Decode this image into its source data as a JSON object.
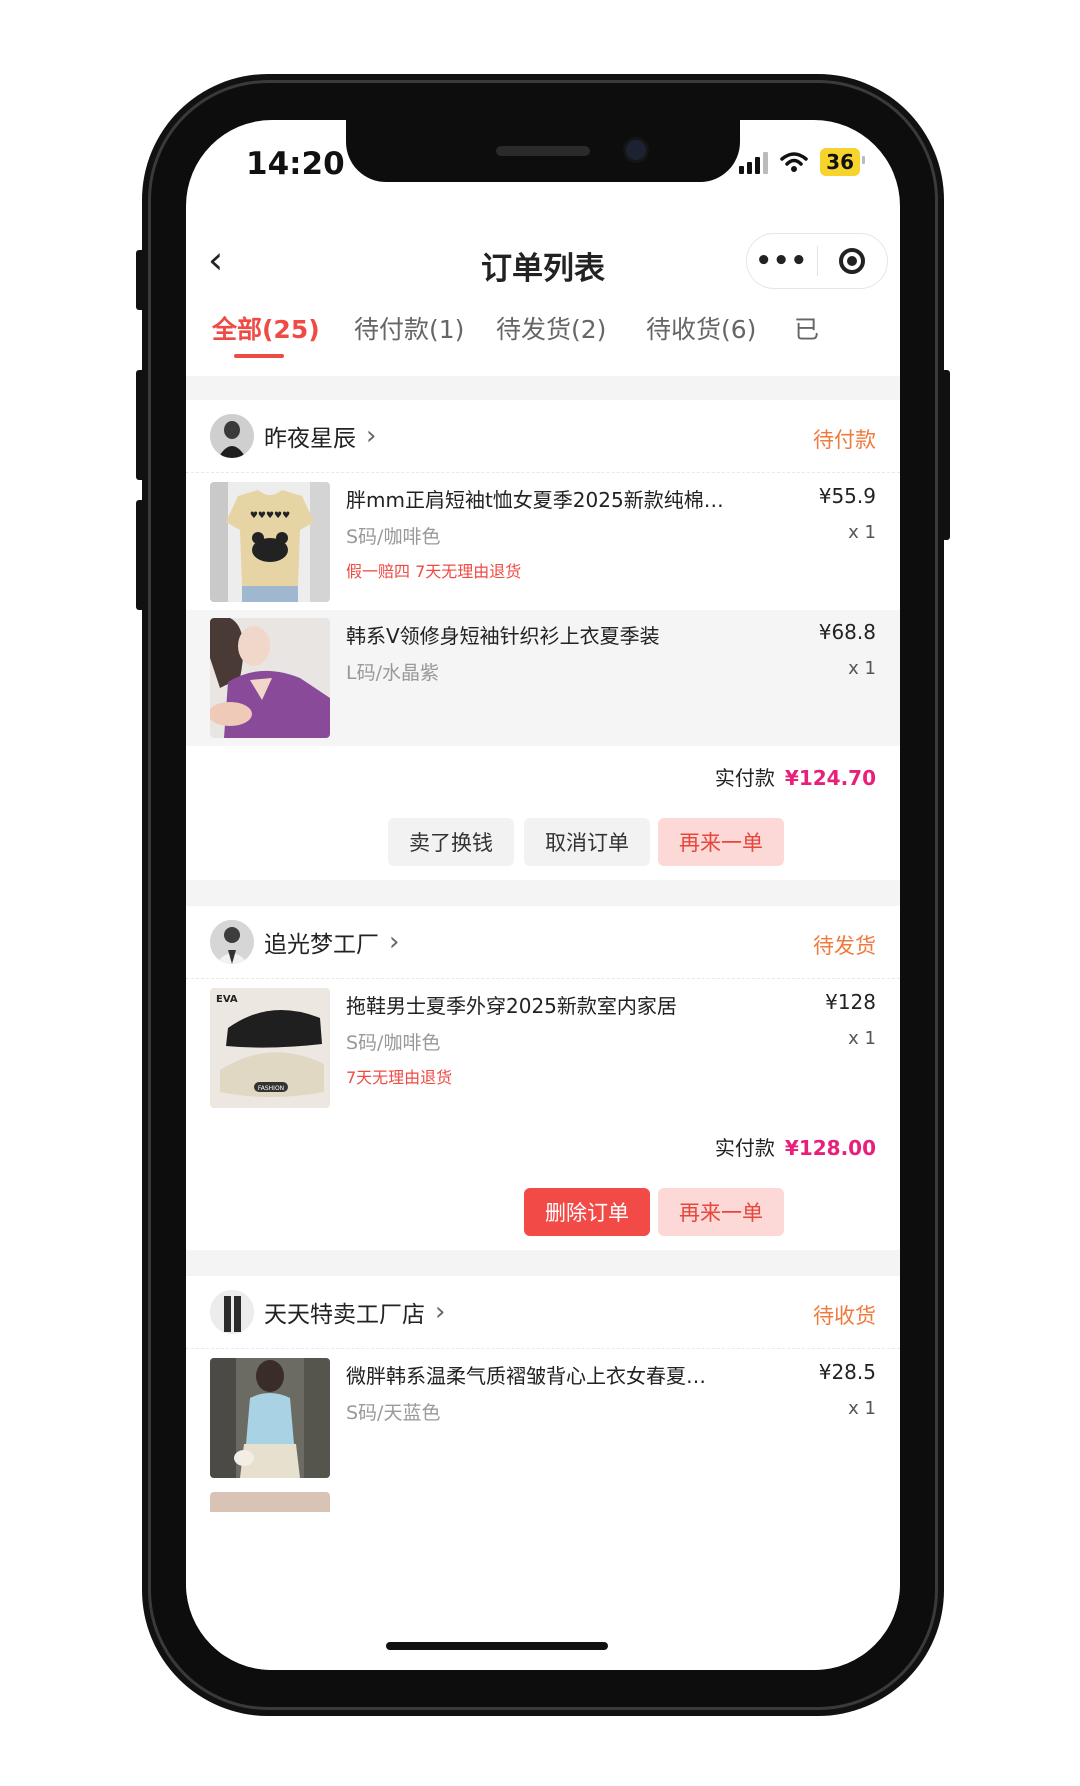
{
  "status_bar": {
    "time": "14:20",
    "battery": "36"
  },
  "nav": {
    "back_icon": "‹",
    "title": "订单列表",
    "more_label": "•••"
  },
  "tabs": [
    {
      "label": "全部(25)",
      "active": true
    },
    {
      "label": "待付款(1)"
    },
    {
      "label": "待发货(2)"
    },
    {
      "label": "待收货(6)"
    },
    {
      "label": "已"
    }
  ],
  "orders": [
    {
      "shop": "昨夜星辰",
      "status": "待付款",
      "items": [
        {
          "name": "胖mm正肩短袖t恤女夏季2025新款纯棉…",
          "price": "¥55.9",
          "spec": "S码/咖啡色",
          "qty": "x 1",
          "tags": "假一赔四 7天无理由退货"
        },
        {
          "name": "韩系V领修身短袖针织衫上衣夏季装",
          "price": "¥68.8",
          "spec": "L码/水晶紫",
          "qty": "x 1"
        }
      ],
      "total_label": "实付款",
      "total": "¥124.70",
      "buttons": [
        "卖了换钱",
        "取消订单",
        "再来一单"
      ]
    },
    {
      "shop": "追光梦工厂",
      "status": "待发货",
      "items": [
        {
          "name": "拖鞋男士夏季外穿2025新款室内家居",
          "price": "¥128",
          "spec": "S码/咖啡色",
          "qty": "x 1",
          "tags": "7天无理由退货"
        }
      ],
      "total_label": "实付款",
      "total": "¥128.00",
      "buttons": [
        "删除订单",
        "再来一单"
      ]
    },
    {
      "shop": "天天特卖工厂店",
      "status": "待收货",
      "items": [
        {
          "name": "微胖韩系温柔气质褶皱背心上衣女春夏…",
          "price": "¥28.5",
          "spec": "S码/天蓝色",
          "qty": "x 1"
        }
      ]
    }
  ],
  "thumb_labels": {
    "eva": "EVA",
    "fashion": "FASHION"
  },
  "colors": {
    "accent_red": "#f04a44",
    "status_orange": "#f07a3c",
    "price_pink": "#e8207a"
  }
}
